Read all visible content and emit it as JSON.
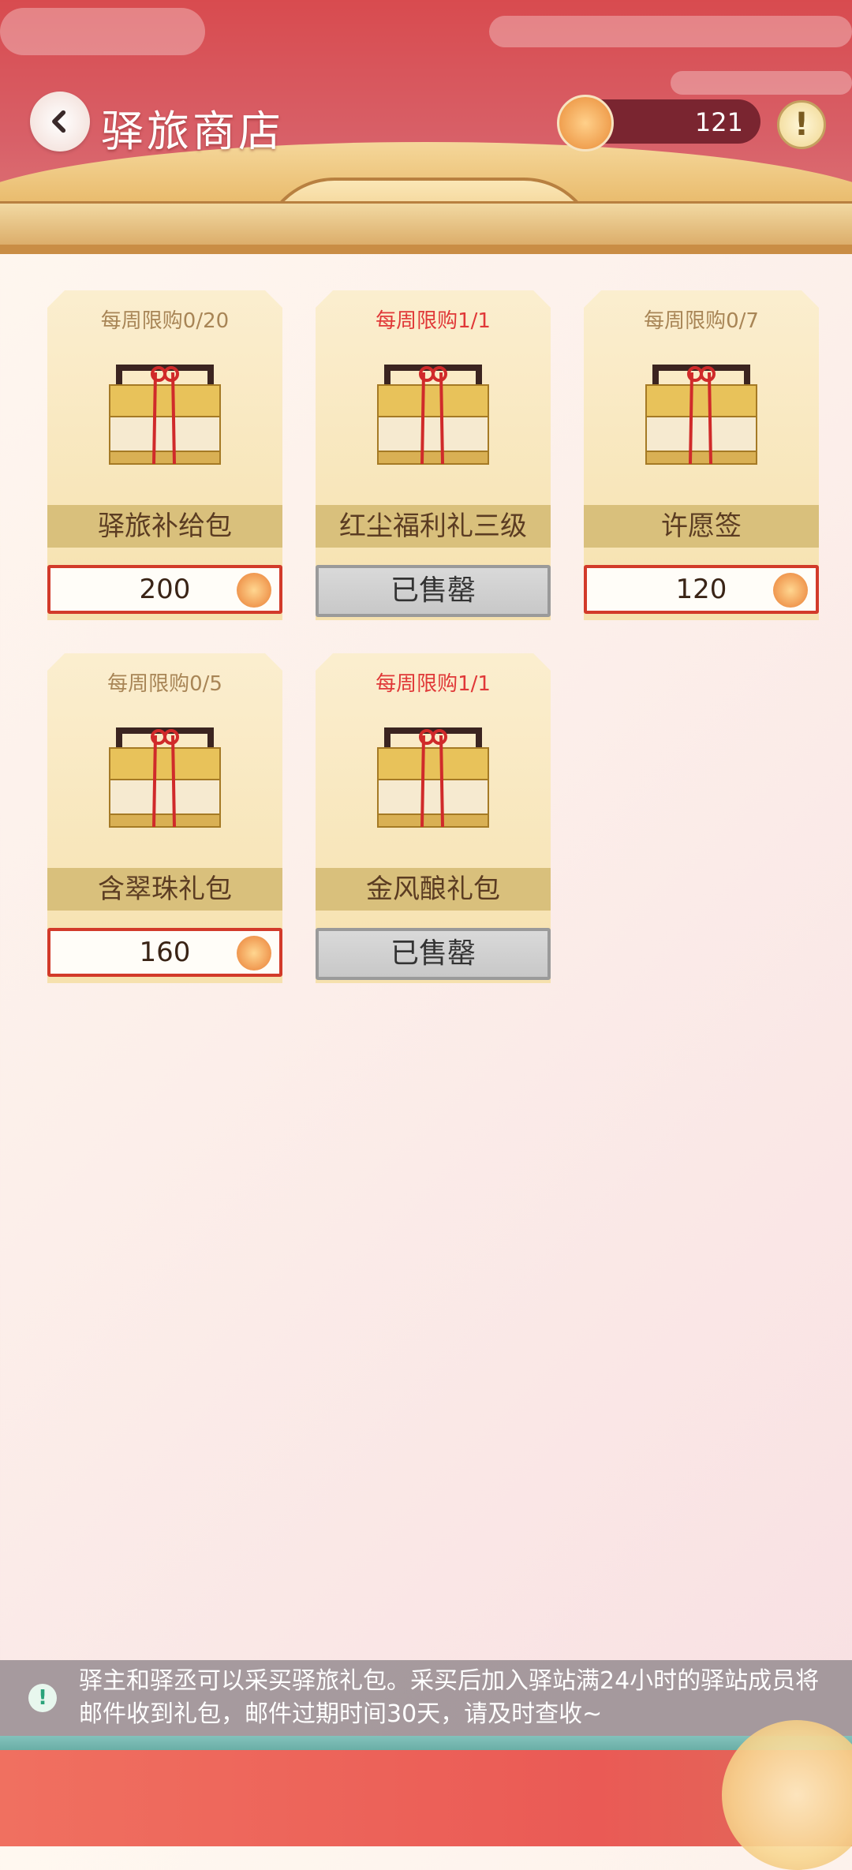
{
  "header": {
    "title": "驿旅商店",
    "currency_value": "121",
    "help_label": "!"
  },
  "items": [
    {
      "limit": "每周限购0/20",
      "name": "驿旅补给包",
      "price": "200",
      "sold_out": false,
      "limit_red": false
    },
    {
      "limit": "每周限购1/1",
      "name": "红尘福利礼三级",
      "price": "已售罄",
      "sold_out": true,
      "limit_red": true
    },
    {
      "limit": "每周限购0/7",
      "name": "许愿签",
      "price": "120",
      "sold_out": false,
      "limit_red": false
    },
    {
      "limit": "每周限购0/5",
      "name": "含翠珠礼包",
      "price": "160",
      "sold_out": false,
      "limit_red": false
    },
    {
      "limit": "每周限购1/1",
      "name": "金风酿礼包",
      "price": "已售罄",
      "sold_out": true,
      "limit_red": true
    }
  ],
  "notice": {
    "text": "驿主和驿丞可以采买驿旅礼包。采买后加入驿站满24小时的驿站成员将邮件收到礼包，邮件过期时间30天，请及时查收~"
  },
  "colors": {
    "header_red": "#d84b4f",
    "price_border": "#d23a2a",
    "limit_red": "#e03838",
    "card_bg": "#f6e1ae"
  }
}
